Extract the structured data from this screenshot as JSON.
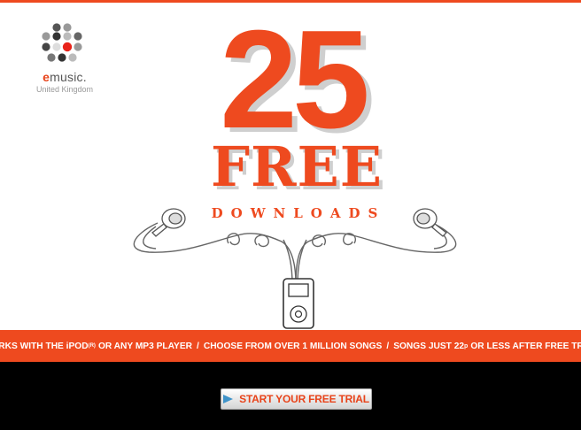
{
  "brand": {
    "name": "emusic.",
    "region": "United Kingdom"
  },
  "headline": {
    "number": "25",
    "word": "FREE",
    "subword": "DOWNLOADS"
  },
  "promo": {
    "part1": "WORKS WITH THE iPOD",
    "mark": "(R)",
    "part2": "OR ANY MP3 PLAYER",
    "part3": "CHOOSE FROM OVER 1 MILLION SONGS",
    "part4a": "SONGS JUST 22",
    "part4unit": "p",
    "part4b": "OR LESS AFTER FREE TRIAL",
    "separator": "/"
  },
  "cta": {
    "label": "START YOUR FREE TRIAL"
  },
  "colors": {
    "accent": "#ee4a1f",
    "background": "#ffffff",
    "footer": "#000000",
    "arrow": "#3f93c9"
  }
}
